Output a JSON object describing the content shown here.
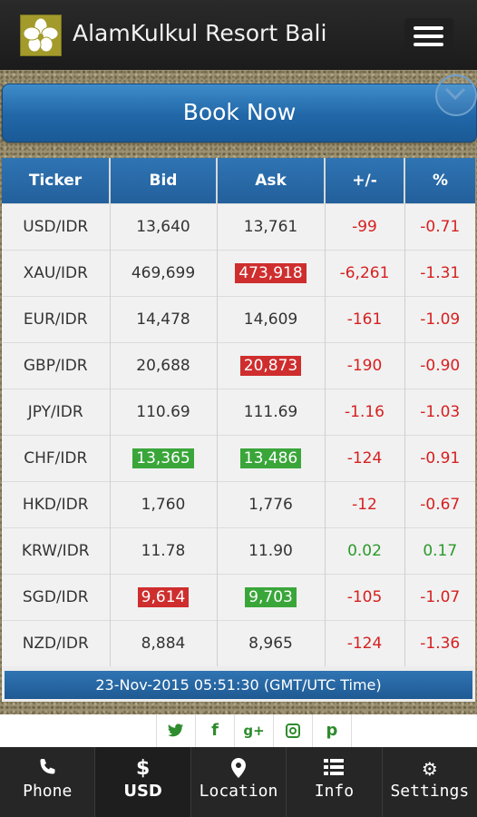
{
  "header": {
    "title": "AlamKulkul Resort Bali"
  },
  "book_button": {
    "label": "Book Now"
  },
  "table": {
    "columns": [
      "Ticker",
      "Bid",
      "Ask",
      "+/-",
      "%"
    ],
    "rows": [
      {
        "ticker": "USD/IDR",
        "bid": "13,640",
        "ask": "13,761",
        "change": "-99",
        "pct": "-0.71"
      },
      {
        "ticker": "XAU/IDR",
        "bid": "469,699",
        "ask": "473,918",
        "change": "-6,261",
        "pct": "-1.31"
      },
      {
        "ticker": "EUR/IDR",
        "bid": "14,478",
        "ask": "14,609",
        "change": "-161",
        "pct": "-1.09"
      },
      {
        "ticker": "GBP/IDR",
        "bid": "20,688",
        "ask": "20,873",
        "change": "-190",
        "pct": "-0.90"
      },
      {
        "ticker": "JPY/IDR",
        "bid": "110.69",
        "ask": "111.69",
        "change": "-1.16",
        "pct": "-1.03"
      },
      {
        "ticker": "CHF/IDR",
        "bid": "13,365",
        "ask": "13,486",
        "change": "-124",
        "pct": "-0.91"
      },
      {
        "ticker": "HKD/IDR",
        "bid": "1,760",
        "ask": "1,776",
        "change": "-12",
        "pct": "-0.67"
      },
      {
        "ticker": "KRW/IDR",
        "bid": "11.78",
        "ask": "11.90",
        "change": "0.02",
        "pct": "0.17"
      },
      {
        "ticker": "SGD/IDR",
        "bid": "9,614",
        "ask": "9,703",
        "change": "-105",
        "pct": "-1.07"
      },
      {
        "ticker": "NZD/IDR",
        "bid": "8,884",
        "ask": "8,965",
        "change": "-124",
        "pct": "-1.36"
      }
    ],
    "timestamp": "23-Nov-2015 05:51:30 (GMT/UTC Time)"
  },
  "social": [
    "twitter-icon",
    "facebook-icon",
    "google-plus-icon",
    "instagram-icon",
    "pinterest-icon"
  ],
  "nav": {
    "phone": "Phone",
    "usd": "USD",
    "location": "Location",
    "info": "Info",
    "settings": "Settings"
  },
  "colors": {
    "header_blue": "#2f74b3",
    "negative": "#d62020",
    "positive": "#2a9a2a",
    "highlight_red": "#cf2e2e",
    "highlight_green": "#3aa63a"
  }
}
